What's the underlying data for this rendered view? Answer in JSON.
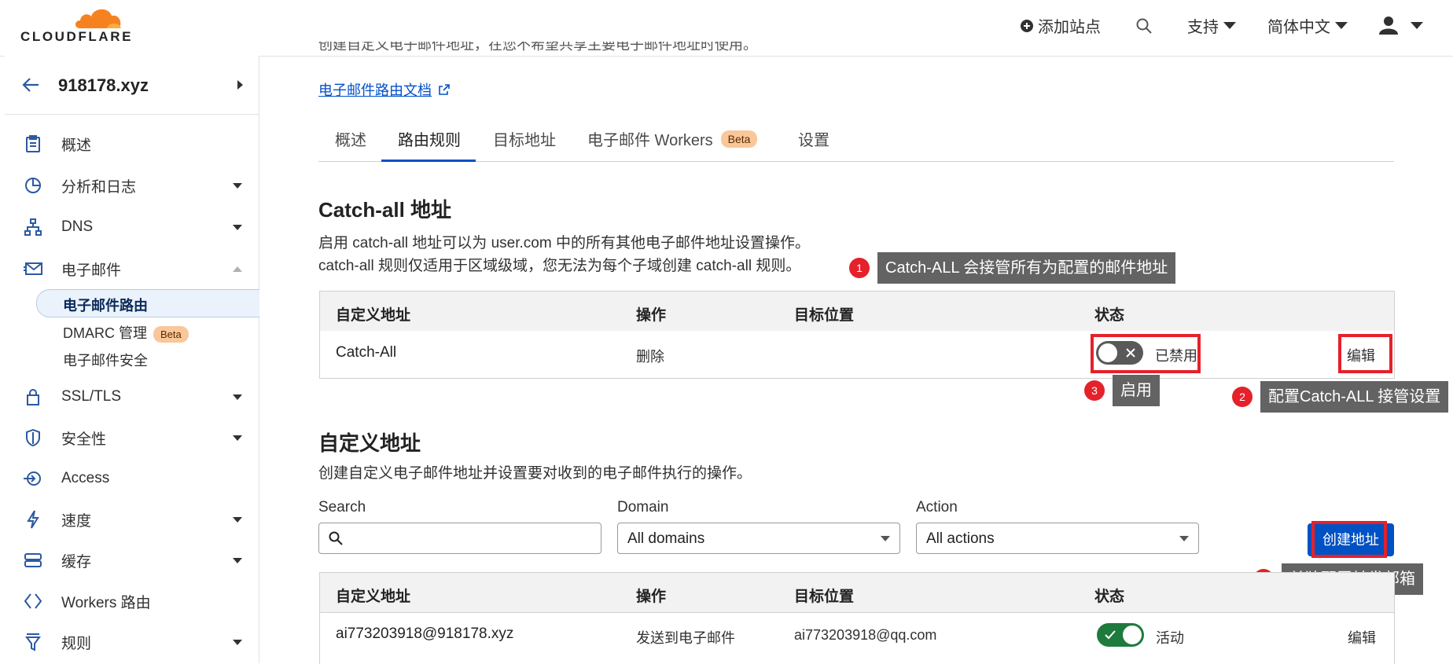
{
  "colors": {
    "accent": "#0051c3",
    "link": "#0550c9",
    "brand_orange": "#f6821f",
    "annotation_red": "#e5212b",
    "toggle_on": "#1f7a3d",
    "toggle_off": "#595959",
    "tooltip": "#636363"
  },
  "header": {
    "logo_text": "CLOUDFLARE",
    "add_site": "添加站点",
    "search_icon": "search-icon",
    "support": "支持",
    "language": "简体中文",
    "user_icon": "user-icon"
  },
  "sidebar": {
    "zone": "918178.xyz",
    "items": [
      {
        "label": "概述",
        "icon": "clipboard-icon"
      },
      {
        "label": "分析和日志",
        "icon": "chart-pie-icon"
      },
      {
        "label": "DNS",
        "icon": "network-icon"
      },
      {
        "label": "电子邮件",
        "icon": "email-icon"
      },
      {
        "label": "SSL/TLS",
        "icon": "lock-icon"
      },
      {
        "label": "安全性",
        "icon": "shield-icon"
      },
      {
        "label": "Access",
        "icon": "access-icon"
      },
      {
        "label": "速度",
        "icon": "lightning-icon"
      },
      {
        "label": "缓存",
        "icon": "storage-icon"
      },
      {
        "label": "Workers 路由",
        "icon": "workers-icon"
      },
      {
        "label": "规则",
        "icon": "funnel-icon"
      }
    ],
    "email_sub": [
      {
        "label": "电子邮件路由"
      },
      {
        "label": "DMARC 管理",
        "badge": "Beta"
      },
      {
        "label": "电子邮件安全"
      }
    ]
  },
  "main": {
    "intro_text": "创建自定义电子邮件地址，在您不希望共享主要电子邮件地址时使用。",
    "docs_link": "电子邮件路由文档",
    "tabs": [
      {
        "label": "概述"
      },
      {
        "label": "路由规则"
      },
      {
        "label": "目标地址"
      },
      {
        "label": "电子邮件 Workers",
        "badge": "Beta"
      },
      {
        "label": "设置"
      }
    ],
    "catchall": {
      "title": "Catch-all 地址",
      "desc1": "启用 catch-all 地址可以为 user.com 中的所有其他电子邮件地址设置操作。",
      "desc2": "catch-all 规则仅适用于区域级域，您无法为每个子域创建 catch-all 规则。",
      "headers": [
        "自定义地址",
        "操作",
        "目标位置",
        "状态"
      ],
      "row": {
        "address": "Catch-All",
        "action": "删除",
        "destination": "",
        "status": "已禁用",
        "edit": "编辑"
      }
    },
    "custom": {
      "title": "自定义地址",
      "desc": "创建自定义电子邮件地址并设置要对收到的电子邮件执行的操作。",
      "search_label": "Search",
      "domain_label": "Domain",
      "domain_value": "All domains",
      "action_label": "Action",
      "action_value": "All actions",
      "create_button": "创建地址",
      "headers": [
        "自定义地址",
        "操作",
        "目标位置",
        "状态"
      ],
      "row": {
        "address": "ai773203918@918178.xyz",
        "action": "发送到电子邮件",
        "destination": "ai773203918@qq.com",
        "status": "活动",
        "edit": "编辑"
      }
    }
  },
  "annotations": [
    {
      "num": "1",
      "text": "Catch-ALL 会接管所有为配置的邮件地址"
    },
    {
      "num": "2",
      "text": "配置Catch-ALL 接管设置"
    },
    {
      "num": "3",
      "text": "启用"
    },
    {
      "num": "4",
      "text": "单独配置转发邮箱"
    }
  ]
}
